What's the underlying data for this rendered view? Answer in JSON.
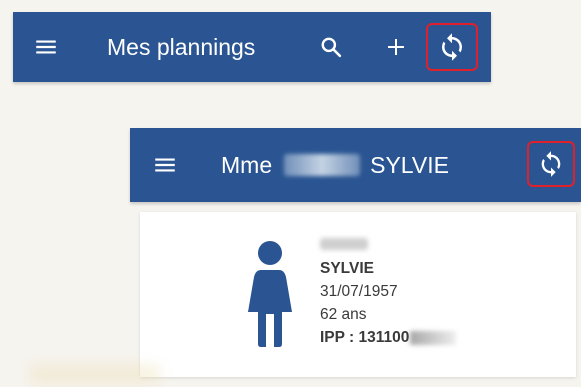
{
  "colors": {
    "primary": "#2a5592",
    "highlight": "#e0202a"
  },
  "planning_bar": {
    "title": "Mes plannings",
    "icons": [
      "menu-icon",
      "search-icon",
      "add-icon",
      "sync-icon"
    ]
  },
  "patient_bar": {
    "title_prefix": "Mme",
    "title_name": "SYLVIE",
    "icons": [
      "menu-icon",
      "sync-icon"
    ]
  },
  "patient_card": {
    "icon": "female-person-icon",
    "first_name": "SYLVIE",
    "birth_date": "31/07/1957",
    "age": "62 ans",
    "ipp": "IPP : 131100"
  }
}
